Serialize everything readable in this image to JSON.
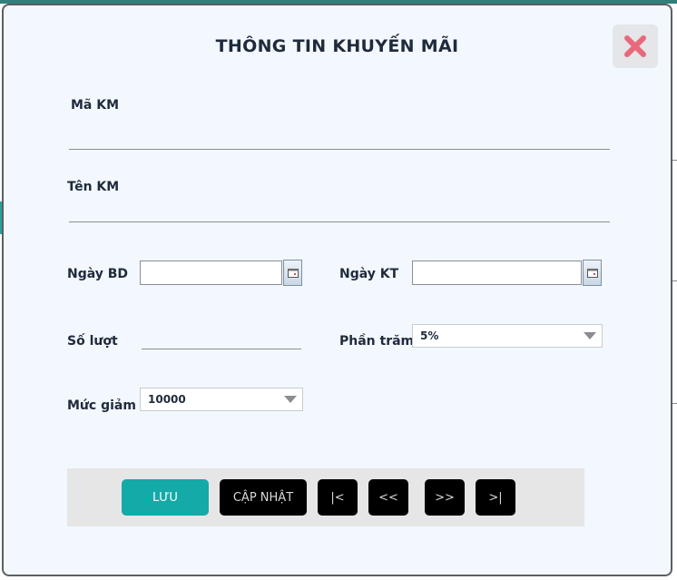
{
  "dialog": {
    "title": "THÔNG TIN KHUYẾN MÃI",
    "close_icon": "close-x-icon",
    "accent_color": "#13aaa8",
    "close_color": "#e8697b"
  },
  "form": {
    "ma_km": {
      "label": "Mã KM",
      "value": ""
    },
    "ten_km": {
      "label": "Tên KM",
      "value": ""
    },
    "ngay_bd": {
      "label": "Ngày BD",
      "value": ""
    },
    "ngay_kt": {
      "label": "Ngày KT",
      "value": ""
    },
    "so_luot": {
      "label": "Số lượt",
      "value": ""
    },
    "phan_tram": {
      "label": "Phần trăm",
      "selected": "5%"
    },
    "muc_giam": {
      "label": "Mức giảm",
      "selected": "10000"
    }
  },
  "toolbar": {
    "save_label": "LƯU",
    "update_label": "CẬP NHẬT",
    "first_label": "|<",
    "prev_label": "<<",
    "next_label": ">>",
    "last_label": ">|"
  }
}
